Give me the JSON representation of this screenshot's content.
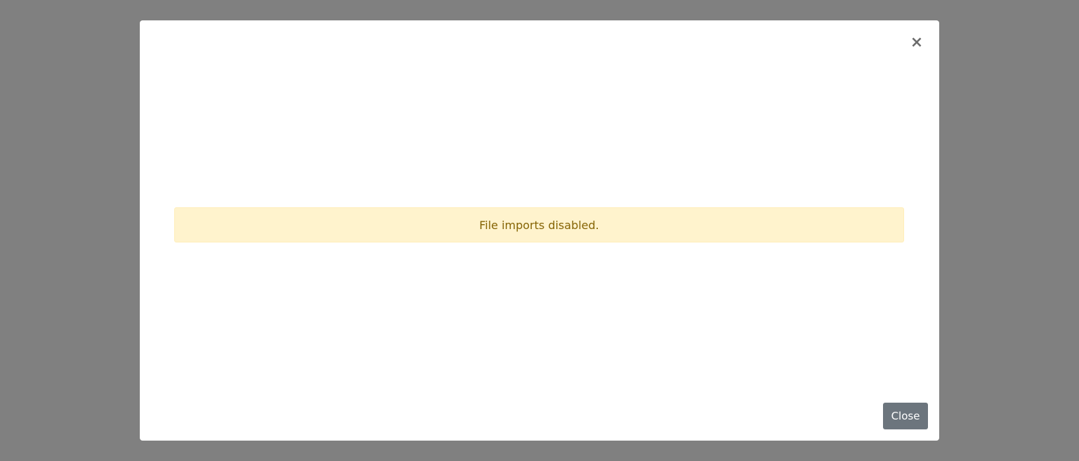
{
  "modal": {
    "close_icon_glyph": "×",
    "close_icon": "close-icon",
    "alert_message": "File imports disabled.",
    "close_button_label": "Close"
  },
  "colors": {
    "backdrop": "#808080",
    "alert_bg": "#fff3cd",
    "alert_text": "#856404",
    "button_bg": "#6c757d"
  }
}
